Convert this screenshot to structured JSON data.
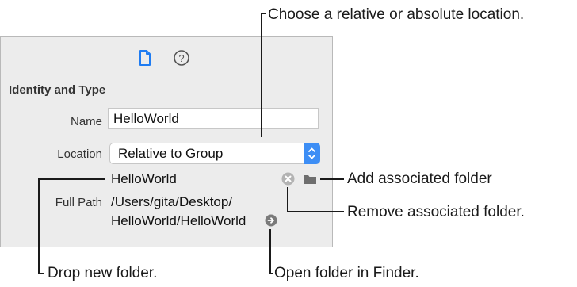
{
  "inspector": {
    "tabs": [
      {
        "icon": "file-icon"
      },
      {
        "icon": "help-icon",
        "glyph": "?"
      }
    ],
    "section_title": "Identity and Type",
    "name": {
      "label": "Name",
      "value": "HelloWorld"
    },
    "location": {
      "label": "Location",
      "selected": "Relative to Group"
    },
    "folder": {
      "name": "HelloWorld"
    },
    "full_path": {
      "label": "Full Path",
      "line1": "/Users/gita/Desktop/",
      "line2": "HelloWorld/HelloWorld"
    }
  },
  "callouts": {
    "choose_location": "Choose a relative or absolute location.",
    "add_folder": "Add associated folder",
    "remove_folder": "Remove associated folder.",
    "drop_folder": "Drop new folder.",
    "open_finder": "Open folder in Finder."
  },
  "colors": {
    "accent": "#3d8ef5",
    "panel_bg": "#ececec"
  }
}
